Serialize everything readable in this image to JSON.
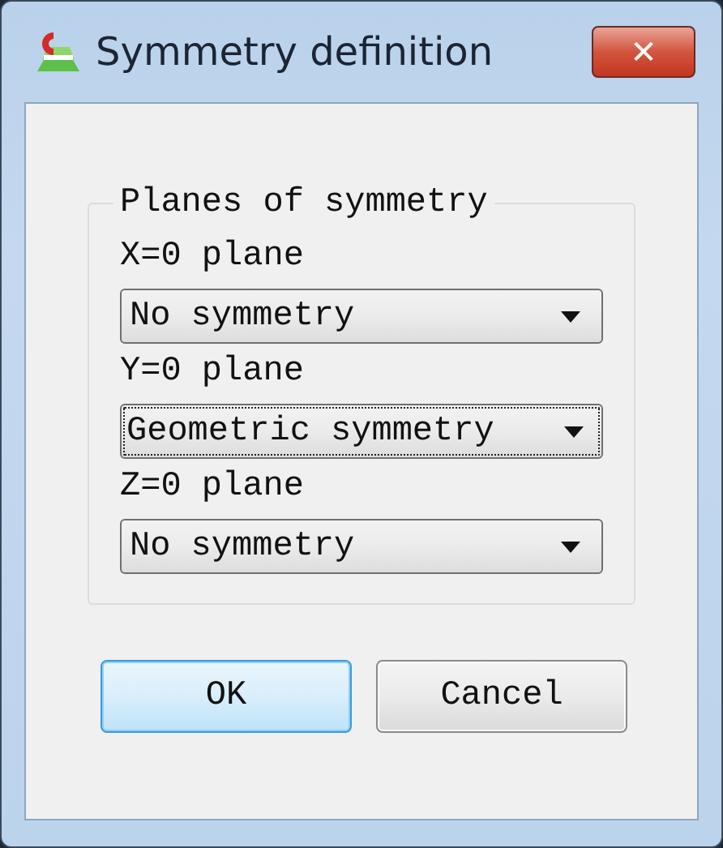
{
  "window": {
    "title": "Symmetry definition",
    "close": "✕"
  },
  "group": {
    "title": "Planes of symmetry",
    "fields": [
      {
        "label": "X=0 plane",
        "value": "No symmetry",
        "focused": false
      },
      {
        "label": "Y=0 plane",
        "value": "Geometric symmetry",
        "focused": true
      },
      {
        "label": "Z=0 plane",
        "value": "No symmetry",
        "focused": false
      }
    ]
  },
  "buttons": [
    {
      "label": "OK",
      "default": true
    },
    {
      "label": "Cancel",
      "default": false
    }
  ]
}
